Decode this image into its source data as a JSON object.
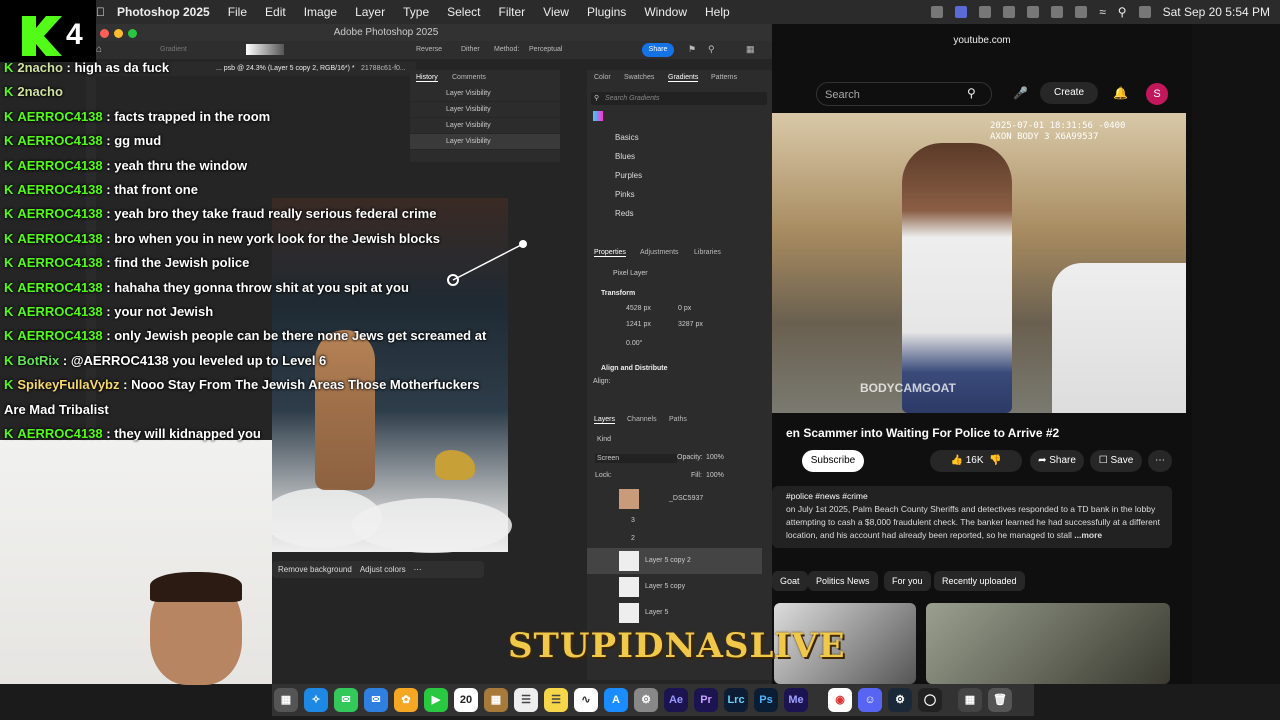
{
  "menubar": {
    "app_name": "Photoshop 2025",
    "items": [
      "File",
      "Edit",
      "Image",
      "Layer",
      "Type",
      "Select",
      "Filter",
      "View",
      "Plugins",
      "Window",
      "Help"
    ],
    "datetime": "Sat Sep 20  5:54 PM"
  },
  "channel_logo": {
    "number": "4"
  },
  "photoshop": {
    "window_title": "Adobe Photoshop 2025",
    "options": {
      "tool": "Gradient",
      "reverse": "Reverse",
      "dither": "Dither",
      "method_label": "Method:",
      "method_value": "Perceptual",
      "share": "Share"
    },
    "doc_tab_1": "... psb @ 24.3% (Layer 5 copy 2, RGB/16*) *",
    "doc_tab_2": "21788c61-f0...",
    "history": {
      "tab_history": "History",
      "tab_comments": "Comments",
      "rows": [
        "Layer Visibility",
        "Layer Visibility",
        "Layer Visibility",
        "Layer Visibility"
      ]
    },
    "color_panel": {
      "tabs": [
        "Color",
        "Swatches",
        "Gradients",
        "Patterns"
      ],
      "search_placeholder": "Search Gradients",
      "folders": [
        "Basics",
        "Blues",
        "Purples",
        "Pinks",
        "Reds"
      ]
    },
    "properties": {
      "tabs": [
        "Properties",
        "Adjustments",
        "Libraries"
      ],
      "kind": "Pixel Layer",
      "transform_label": "Transform",
      "w": "4528 px",
      "h": "1241 px",
      "x": "0 px",
      "y": "3287 px",
      "angle": "0.00°",
      "align_label": "Align and Distribute",
      "align_sub": "Align:"
    },
    "layers": {
      "tabs": [
        "Layers",
        "Channels",
        "Paths"
      ],
      "filter": "Kind",
      "blend_mode": "Screen",
      "opacity_label": "Opacity:",
      "opacity": "100%",
      "lock_label": "Lock:",
      "fill_label": "Fill:",
      "fill": "100%",
      "rows": [
        "_DSC5937",
        "3",
        "2",
        "Layer 5 copy 2",
        "Layer 5 copy",
        "Layer 5"
      ]
    },
    "context_bar": {
      "remove_bg": "Remove background",
      "adjust_colors": "Adjust colors"
    }
  },
  "chat": [
    {
      "user": "2nacho",
      "message": "high as da fuck",
      "style": "pink"
    },
    {
      "user": "2nacho",
      "message": "",
      "style": "pink"
    },
    {
      "user": "AERROC4138",
      "message": "facts trapped in the room",
      "style": "green"
    },
    {
      "user": "AERROC4138",
      "message": "gg mud",
      "style": "green"
    },
    {
      "user": "AERROC4138",
      "message": "yeah thru the window",
      "style": "green"
    },
    {
      "user": "AERROC4138",
      "message": "that front one",
      "style": "green"
    },
    {
      "user": "AERROC4138",
      "message": "yeah bro they take fraud really serious federal crime",
      "style": "green"
    },
    {
      "user": "AERROC4138",
      "message": "bro when you in new york look for the Jewish blocks",
      "style": "green"
    },
    {
      "user": "AERROC4138",
      "message": "find the Jewish police",
      "style": "green"
    },
    {
      "user": "AERROC4138",
      "message": "hahaha they gonna throw shit at you spit at you",
      "style": "green"
    },
    {
      "user": "AERROC4138",
      "message": "your not Jewish",
      "style": "green"
    },
    {
      "user": "AERROC4138",
      "message": "only Jewish people can be there none Jews get screamed at",
      "style": "green"
    },
    {
      "user": "BotRix",
      "message": "@AERROC4138 you leveled up to Level 6",
      "style": "bot"
    },
    {
      "user": "SpikeyFullaVybz",
      "message": "Nooo Stay From The Jewish Areas Those Motherfuckers",
      "style": "yel"
    },
    {
      "user": "",
      "message": "Are Mad Tribalist",
      "style": "cont"
    },
    {
      "user": "AERROC4138",
      "message": "they will kidnapped you",
      "style": "green"
    }
  ],
  "watermark": "STUPIDNASLIVE",
  "browser": {
    "url": "youtube.com",
    "search_placeholder": "Search",
    "create": "Create",
    "avatar_letter": "S",
    "video_timestamp": "2025-07-01 18:31:56 -0400",
    "video_cam": "AXON BODY 3 X6A99537",
    "video_watermark": "BODYCAMGOAT",
    "video_title": "en Scammer into Waiting For Police to Arrive #2",
    "subscribe": "Subscribe",
    "likes": "16K",
    "share": "Share",
    "save": "Save",
    "hashtags": "#police #news #crime",
    "description": "on July 1st 2025, Palm Beach County Sheriffs and detectives responded to a TD bank in the lobby attempting to cash a $8,000 fraudulent check. The banker learned he had successfully at a different location, and his account had already been reported, so he managed to stall",
    "more": "...more",
    "chips": [
      "Goat",
      "Politics News",
      "For you",
      "Recently uploaded"
    ]
  },
  "dock": {
    "items": [
      "Ae",
      "Pr",
      "Lrc",
      "Ps",
      "Me"
    ],
    "calendar_day": "20"
  }
}
